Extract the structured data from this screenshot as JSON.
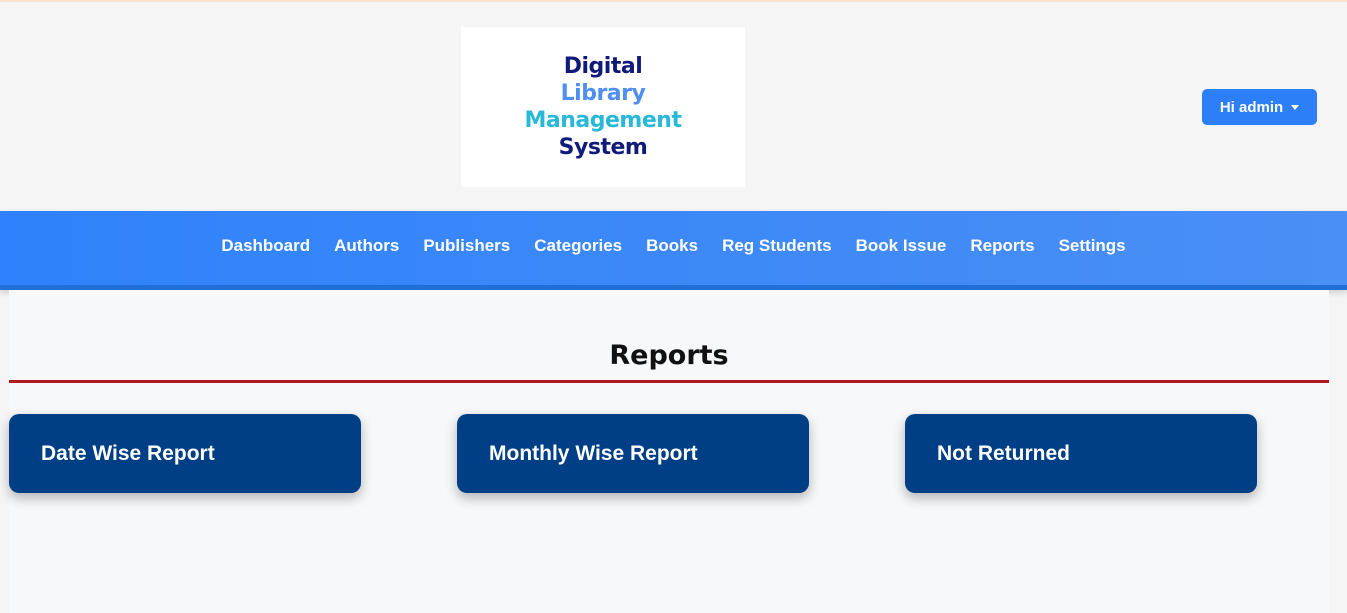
{
  "logo": {
    "lines": [
      "Digital",
      "Library",
      "Management",
      "System"
    ],
    "colors": [
      "#101a7a",
      "#4f8ff0",
      "#28b8d8",
      "#101a7a"
    ]
  },
  "user_menu": {
    "label": "Hi admin",
    "icon": "caret-down-icon"
  },
  "nav": {
    "items": [
      "Dashboard",
      "Authors",
      "Publishers",
      "Categories",
      "Books",
      "Reg Students",
      "Book Issue",
      "Reports",
      "Settings"
    ]
  },
  "page": {
    "title": "Reports"
  },
  "cards": [
    "Date Wise Report",
    "Monthly Wise Report",
    "Not Returned"
  ],
  "colors": {
    "navbar": "#2f82fb",
    "button": "#2c7ff7",
    "card": "#003f85",
    "title_rule": "#b01b22"
  }
}
